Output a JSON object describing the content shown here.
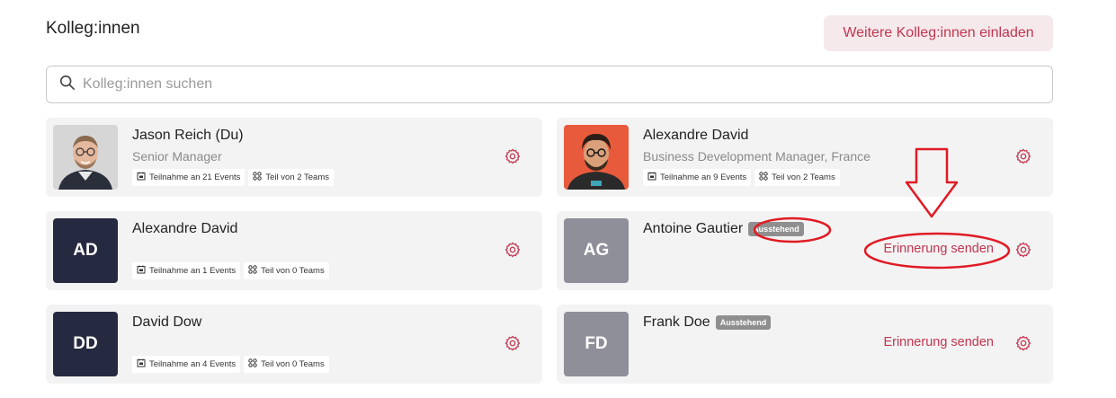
{
  "header": {
    "title": "Kolleg:innen",
    "invite_label": "Weitere Kolleg:innen einladen"
  },
  "search": {
    "placeholder": "Kolleg:innen suchen",
    "value": ""
  },
  "colleagues": [
    {
      "name": "Jason Reich (Du)",
      "role": "Senior Manager",
      "events": "Teilnahme an 21 Events",
      "teams": "Teil von 2 Teams"
    },
    {
      "name": "Alexandre David",
      "role": "Business Development Manager, France",
      "events": "Teilnahme an 9 Events",
      "teams": "Teil von 2 Teams"
    },
    {
      "initials": "AD",
      "name": "Alexandre David",
      "events": "Teilnahme an 1 Events",
      "teams": "Teil von 0 Teams"
    },
    {
      "initials": "AG",
      "name": "Antoine Gautier",
      "badge": "Ausstehend",
      "remind_label": "Erinnerung senden"
    },
    {
      "initials": "DD",
      "name": "David Dow",
      "events": "Teilnahme an 4 Events",
      "teams": "Teil von 0 Teams"
    },
    {
      "initials": "FD",
      "name": "Frank Doe",
      "badge": "Ausstehend",
      "remind_label": "Erinnerung senden"
    }
  ],
  "icons": {
    "search": "search-icon",
    "settings": "gear-icon",
    "events": "calendar-icon",
    "teams": "teams-grid-icon"
  },
  "colors": {
    "accent": "#c2354f",
    "invite_bg": "#f6e9ec",
    "card_bg": "#f3f3f3",
    "avatar_dark": "#262a40",
    "avatar_grey": "#8f8f99",
    "badge_bg": "#8f8f8f",
    "annotation": "#e01b24"
  }
}
